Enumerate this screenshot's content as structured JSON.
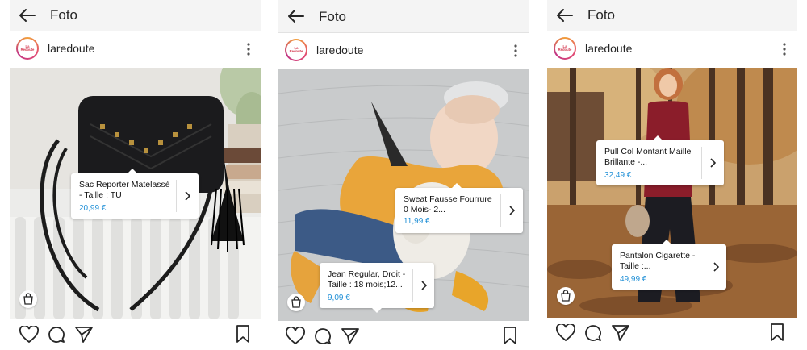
{
  "panels": [
    {
      "header_title": "Foto",
      "username": "laredoute",
      "avatar_text": "La Redoute",
      "tags": [
        {
          "name": "Sac Reporter Matelassé - Taille : TU",
          "price": "20,99 €"
        }
      ]
    },
    {
      "header_title": "Foto",
      "username": "laredoute",
      "avatar_text": "La Redoute",
      "tags": [
        {
          "name": "Sweat Fausse Fourrure 0 Mois- 2...",
          "price": "11,99 €"
        },
        {
          "name": "Jean Regular, Droit - Taille : 18 mois;12...",
          "price": "9,09 €"
        }
      ]
    },
    {
      "header_title": "Foto",
      "username": "laredoute",
      "avatar_text": "La Redoute",
      "tags": [
        {
          "name": "Pull Col Montant Maille Brillante -...",
          "price": "32,49 €"
        },
        {
          "name": "Pantalon Cigarette - Taille :...",
          "price": "49,99 €"
        }
      ]
    }
  ],
  "icons": {
    "back": "arrow-left-icon",
    "more": "more-vertical-icon",
    "shop": "shopping-bag-icon",
    "like": "heart-icon",
    "comment": "comment-icon",
    "share": "paper-plane-icon",
    "save": "bookmark-icon",
    "tag_arrow": "chevron-right-icon"
  },
  "colors": {
    "price": "#1f8fd6",
    "appbar": "#f4f4f4"
  }
}
